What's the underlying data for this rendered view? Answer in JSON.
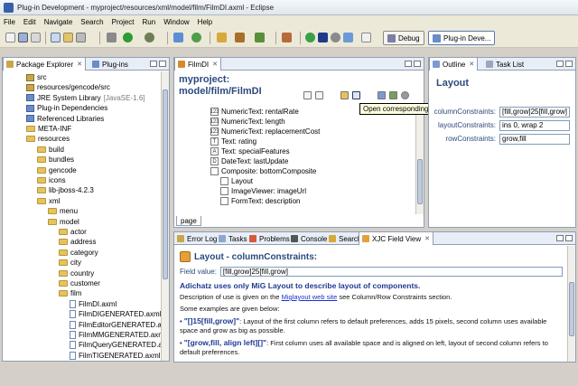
{
  "window": {
    "title": "Plug-in Development - myproject/resources/xml/model/film/FilmDI.axml - Eclipse"
  },
  "menu": [
    "File",
    "Edit",
    "Navigate",
    "Search",
    "Project",
    "Run",
    "Window",
    "Help"
  ],
  "perspectives": {
    "debug": "Debug",
    "plugin": "Plug-in Deve..."
  },
  "left_pane": {
    "tabs": [
      "Package Explorer",
      "Plug-ins"
    ],
    "tree": [
      {
        "label": "src",
        "icon": "package-folder",
        "depth": 1
      },
      {
        "label": "resources/gencode/src",
        "icon": "package-folder",
        "depth": 1
      },
      {
        "label": "JRE System Library",
        "suffix": "[JavaSE-1.6]",
        "icon": "library",
        "depth": 1
      },
      {
        "label": "Plug-in Dependencies",
        "icon": "library",
        "depth": 1
      },
      {
        "label": "Referenced Libraries",
        "icon": "library",
        "depth": 1
      },
      {
        "label": "META-INF",
        "icon": "folder",
        "depth": 1
      },
      {
        "label": "resources",
        "icon": "folder",
        "depth": 1
      },
      {
        "label": "build",
        "icon": "folder",
        "depth": 2
      },
      {
        "label": "bundles",
        "icon": "folder",
        "depth": 2
      },
      {
        "label": "gencode",
        "icon": "folder",
        "depth": 2
      },
      {
        "label": "icons",
        "icon": "folder",
        "depth": 2
      },
      {
        "label": "lib-jboss-4.2.3",
        "icon": "folder",
        "depth": 2
      },
      {
        "label": "xml",
        "icon": "folder",
        "depth": 2
      },
      {
        "label": "menu",
        "icon": "folder",
        "depth": 3
      },
      {
        "label": "model",
        "icon": "folder",
        "depth": 3
      },
      {
        "label": "actor",
        "icon": "folder",
        "depth": 4
      },
      {
        "label": "address",
        "icon": "folder",
        "depth": 4
      },
      {
        "label": "category",
        "icon": "folder",
        "depth": 4
      },
      {
        "label": "city",
        "icon": "folder",
        "depth": 4
      },
      {
        "label": "country",
        "icon": "folder",
        "depth": 4
      },
      {
        "label": "customer",
        "icon": "folder",
        "depth": 4
      },
      {
        "label": "film",
        "icon": "folder",
        "depth": 4
      },
      {
        "label": "FilmDI.axml",
        "icon": "file",
        "depth": 5
      },
      {
        "label": "FilmDIGENERATED.axml",
        "icon": "file",
        "depth": 5
      },
      {
        "label": "FilmEditorGENERATED.axml",
        "icon": "file",
        "depth": 5
      },
      {
        "label": "FilmMMGENERATED.axml",
        "icon": "file",
        "depth": 5
      },
      {
        "label": "FilmQueryGENERATED.axml",
        "icon": "file",
        "depth": 5
      },
      {
        "label": "FilmTIGENERATED.axml",
        "icon": "file",
        "depth": 5
      }
    ]
  },
  "editor": {
    "tab": "FilmDI",
    "title_line1": "myproject:",
    "title_line2": "model/film/FilmDI",
    "tooltip": "Open corresponding XML file",
    "components": [
      {
        "label": "NumericText: rentalRate",
        "icon": "123",
        "indent": 0
      },
      {
        "label": "NumericText: length",
        "icon": "123",
        "indent": 0
      },
      {
        "label": "NumericText: replacementCost",
        "icon": "123",
        "indent": 0
      },
      {
        "label": "Text: rating",
        "icon": "T",
        "indent": 0
      },
      {
        "label": "Text: specialFeatures",
        "icon": "A",
        "indent": 0
      },
      {
        "label": "DateText: lastUpdate",
        "icon": "D",
        "indent": 0
      },
      {
        "label": "Composite: bottomComposite",
        "icon": "",
        "indent": 0
      },
      {
        "label": "Layout",
        "icon": "",
        "indent": 1
      },
      {
        "label": "ImageViewer: imageUrl",
        "icon": "",
        "indent": 1
      },
      {
        "label": "FormText: description",
        "icon": "",
        "indent": 1
      }
    ],
    "page_tab": "page"
  },
  "outline": {
    "tabs": [
      "Outline",
      "Task List"
    ],
    "title": "Layout",
    "properties": [
      {
        "label": "columnConstraints:",
        "value": "[fill,grow]25[fill,grow]"
      },
      {
        "label": "layoutConstraints:",
        "value": "ins 0, wrap 2"
      },
      {
        "label": "rowConstraints:",
        "value": "grow,fill"
      }
    ]
  },
  "bottom": {
    "tabs": [
      "Error Log",
      "Tasks",
      "Problems",
      "Console",
      "Search",
      "XJC Field View"
    ],
    "doc_title": "Layout - columnConstraints:",
    "field_label": "Field value:",
    "field_value": "[fill,grow]25[fill,grow]",
    "headline": "Adichatz uses only MiG Layout to describe layout of components.",
    "desc_prefix": "Description of use is given on the",
    "desc_link": "Miglayout web site",
    "desc_suffix": "see Column/Row Constraints section.",
    "examples_intro": "Some examples are given below:",
    "ex1_code": "\"[]15[fill,grow]\"",
    "ex1_text": ": Layout of the first column refers to default preferences, adds 15 pixels, second column uses available space and grow as big as possible.",
    "ex2_code": "\"[grow,fill, align left][]\"",
    "ex2_text": ": First column uses all available space and is aligned on left, layout of second column refers to default preferences."
  }
}
